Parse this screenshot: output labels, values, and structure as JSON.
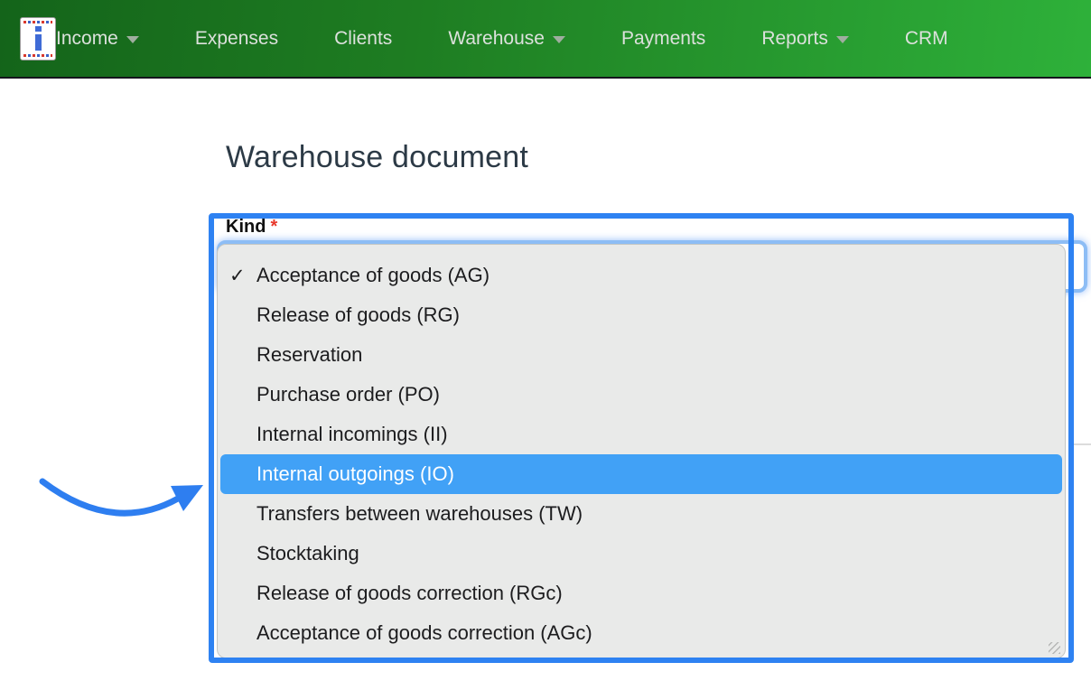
{
  "nav": {
    "logo_name": "brand-logo",
    "items": [
      {
        "label": "Income",
        "has_caret": true
      },
      {
        "label": "Expenses",
        "has_caret": false
      },
      {
        "label": "Clients",
        "has_caret": false
      },
      {
        "label": "Warehouse",
        "has_caret": true
      },
      {
        "label": "Payments",
        "has_caret": false
      },
      {
        "label": "Reports",
        "has_caret": true
      },
      {
        "label": "CRM",
        "has_caret": false
      }
    ]
  },
  "page": {
    "title": "Warehouse document"
  },
  "form": {
    "kind_label": "Kind",
    "required_marker": "*"
  },
  "dropdown": {
    "checkmark": "✓",
    "items": [
      {
        "label": "Acceptance of goods (AG)",
        "checked": true,
        "highlighted": false
      },
      {
        "label": "Release of goods (RG)",
        "checked": false,
        "highlighted": false
      },
      {
        "label": "Reservation",
        "checked": false,
        "highlighted": false
      },
      {
        "label": "Purchase order (PO)",
        "checked": false,
        "highlighted": false
      },
      {
        "label": "Internal incomings (II)",
        "checked": false,
        "highlighted": false
      },
      {
        "label": "Internal outgoings (IO)",
        "checked": false,
        "highlighted": true
      },
      {
        "label": "Transfers between warehouses (TW)",
        "checked": false,
        "highlighted": false
      },
      {
        "label": "Stocktaking",
        "checked": false,
        "highlighted": false
      },
      {
        "label": "Release of goods correction (RGc)",
        "checked": false,
        "highlighted": false
      },
      {
        "label": "Acceptance of goods correction (AGc)",
        "checked": false,
        "highlighted": false
      }
    ]
  },
  "colors": {
    "annotation_blue": "#2e82f2",
    "highlight_blue": "#41a1f6",
    "navbar_green_left": "#14641a",
    "navbar_green_right": "#2eb13a",
    "focus_ring_blue": "#8dbdf5",
    "required_red": "#e8382b"
  }
}
